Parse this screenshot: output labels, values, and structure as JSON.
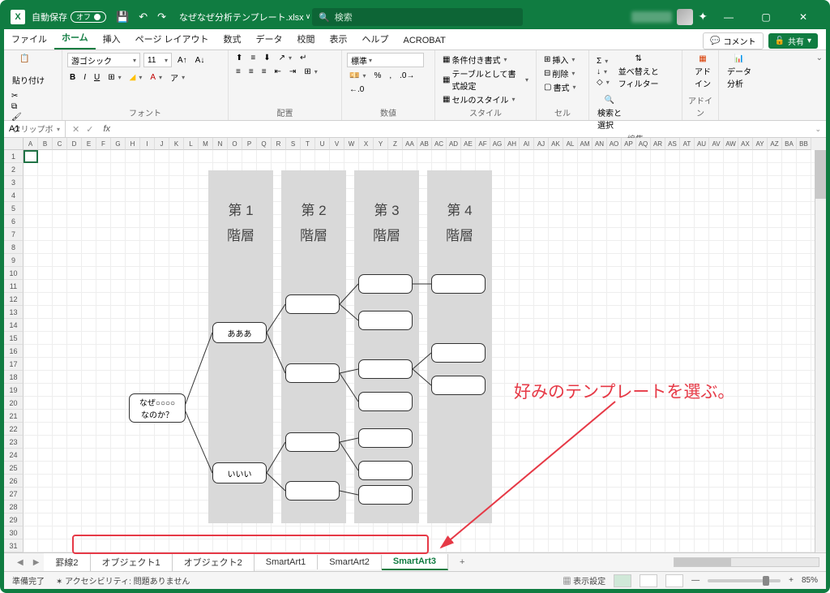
{
  "title": {
    "autosave_label": "自動保存",
    "autosave_state": "オフ",
    "filename": "なぜなぜ分析テンプレート.xlsx",
    "search_placeholder": "検索"
  },
  "ribbon_tabs": [
    "ファイル",
    "ホーム",
    "挿入",
    "ページ レイアウト",
    "数式",
    "データ",
    "校閲",
    "表示",
    "ヘルプ",
    "ACROBAT"
  ],
  "ribbon_right": {
    "comment": "コメント",
    "share": "共有"
  },
  "ribbon": {
    "clipboard": {
      "paste": "貼り付け",
      "label": "クリップボード"
    },
    "font": {
      "name": "游ゴシック",
      "size": "11",
      "label": "フォント"
    },
    "alignment": {
      "label": "配置"
    },
    "number": {
      "format": "標準",
      "label": "数値"
    },
    "styles": {
      "cond": "条件付き書式",
      "table": "テーブルとして書式設定",
      "cell": "セルのスタイル",
      "label": "スタイル"
    },
    "cells": {
      "insert": "挿入",
      "delete": "削除",
      "format": "書式",
      "label": "セル"
    },
    "editing": {
      "sort": "並べ替えと\nフィルター",
      "find": "検索と\n選択",
      "label": "編集"
    },
    "addins": {
      "addin": "アド\nイン",
      "label": "アドイン"
    },
    "analysis": {
      "data": "データ\n分析",
      "label": ""
    }
  },
  "namebox": "A1",
  "columns": [
    "A",
    "B",
    "C",
    "D",
    "E",
    "F",
    "G",
    "H",
    "I",
    "J",
    "K",
    "L",
    "M",
    "N",
    "O",
    "P",
    "Q",
    "R",
    "S",
    "T",
    "U",
    "V",
    "W",
    "X",
    "Y",
    "Z",
    "AA",
    "AB",
    "AC",
    "AD",
    "AE",
    "AF",
    "AG",
    "AH",
    "AI",
    "AJ",
    "AK",
    "AL",
    "AM",
    "AN",
    "AO",
    "AP",
    "AQ",
    "AR",
    "AS",
    "AT",
    "AU",
    "AV",
    "AW",
    "AX",
    "AY",
    "AZ",
    "BA",
    "BB"
  ],
  "rows_count": 31,
  "smartart": {
    "bands": [
      "第 1\n階層",
      "第 2\n階層",
      "第 3\n階層",
      "第 4\n階層"
    ],
    "root": "なぜ○○○○\nなのか？",
    "level1": [
      "あああ",
      "いいい"
    ]
  },
  "annotation": "好みのテンプレートを選ぶ。",
  "sheet_tabs": [
    "罫線2",
    "オブジェクト1",
    "オブジェクト2",
    "SmartArt1",
    "SmartArt2",
    "SmartArt3"
  ],
  "statusbar": {
    "ready": "準備完了",
    "accessibility": "アクセシビリティ: 問題ありません",
    "display_settings": "表示設定",
    "zoom": "85%"
  }
}
